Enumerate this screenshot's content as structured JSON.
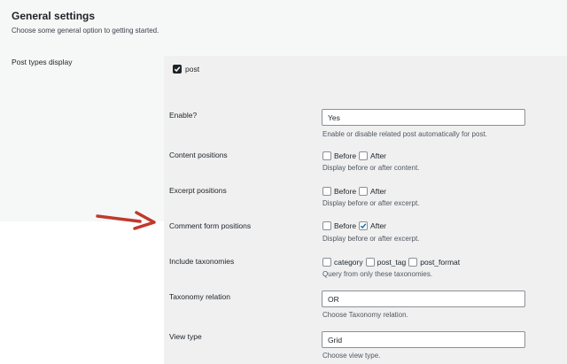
{
  "header": {
    "title": "General settings",
    "subtitle": "Choose some general option to getting started."
  },
  "post_types": {
    "label": "Post types display",
    "checkbox_label": "post",
    "checked": true
  },
  "settings": {
    "enable": {
      "label": "Enable?",
      "value": "Yes",
      "description": "Enable or disable related post automatically for post."
    },
    "content_positions": {
      "label": "Content positions",
      "options": [
        "Before",
        "After"
      ],
      "checked": [
        false,
        false
      ],
      "description": "Display before or after content."
    },
    "excerpt_positions": {
      "label": "Excerpt positions",
      "options": [
        "Before",
        "After"
      ],
      "checked": [
        false,
        false
      ],
      "description": "Display before or after excerpt."
    },
    "comment_form_positions": {
      "label": "Comment form positions",
      "options": [
        "Before",
        "After"
      ],
      "checked": [
        false,
        true
      ],
      "description": "Display before or after excerpt."
    },
    "include_taxonomies": {
      "label": "Include taxonomies",
      "options": [
        "category",
        "post_tag",
        "post_format"
      ],
      "checked": [
        false,
        false,
        false
      ],
      "description": "Query from only these taxonomies."
    },
    "taxonomy_relation": {
      "label": "Taxonomy relation",
      "value": "OR",
      "description": "Choose Taxonomy relation."
    },
    "view_type": {
      "label": "View type",
      "value": "Grid",
      "description": "Choose view type."
    }
  },
  "annotation": {
    "arrow_color": "#c0392b"
  },
  "colors": {
    "accent": "#2271b1",
    "panel": "#f0f0f1"
  }
}
